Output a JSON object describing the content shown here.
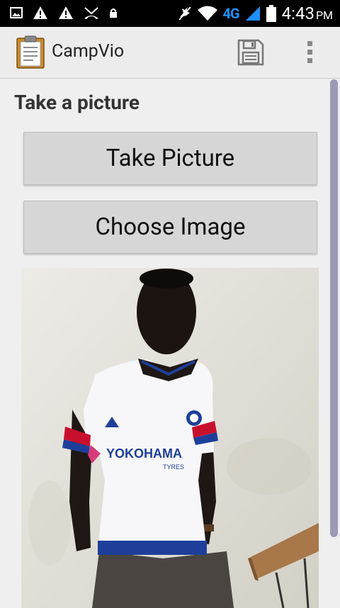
{
  "status_bar": {
    "network_type": "4G",
    "time": "4:43",
    "ampm": "PM",
    "icons": [
      "image-icon",
      "warning-icon",
      "warning-icon",
      "missed-call-icon",
      "lock-icon",
      "mute-icon",
      "wifi-icon",
      "signal-icon",
      "battery-icon"
    ]
  },
  "action_bar": {
    "app_title": "CampVio",
    "app_icon": "clipboard-icon",
    "save_icon": "floppy-disk-icon",
    "overflow_icon": "more-vert-icon"
  },
  "content": {
    "section_title": "Take a picture",
    "take_picture_label": "Take Picture",
    "choose_image_label": "Choose Image",
    "photo": {
      "jersey_sponsor": "YOKOHAMA",
      "jersey_sponsor_sub": "TYRES"
    }
  },
  "colors": {
    "status_bar_bg": "#000000",
    "network_accent": "#1e90ff",
    "action_bar_bg": "#ececec",
    "button_bg": "#d6d6d6",
    "scrollbar": "#9a9ab5"
  }
}
